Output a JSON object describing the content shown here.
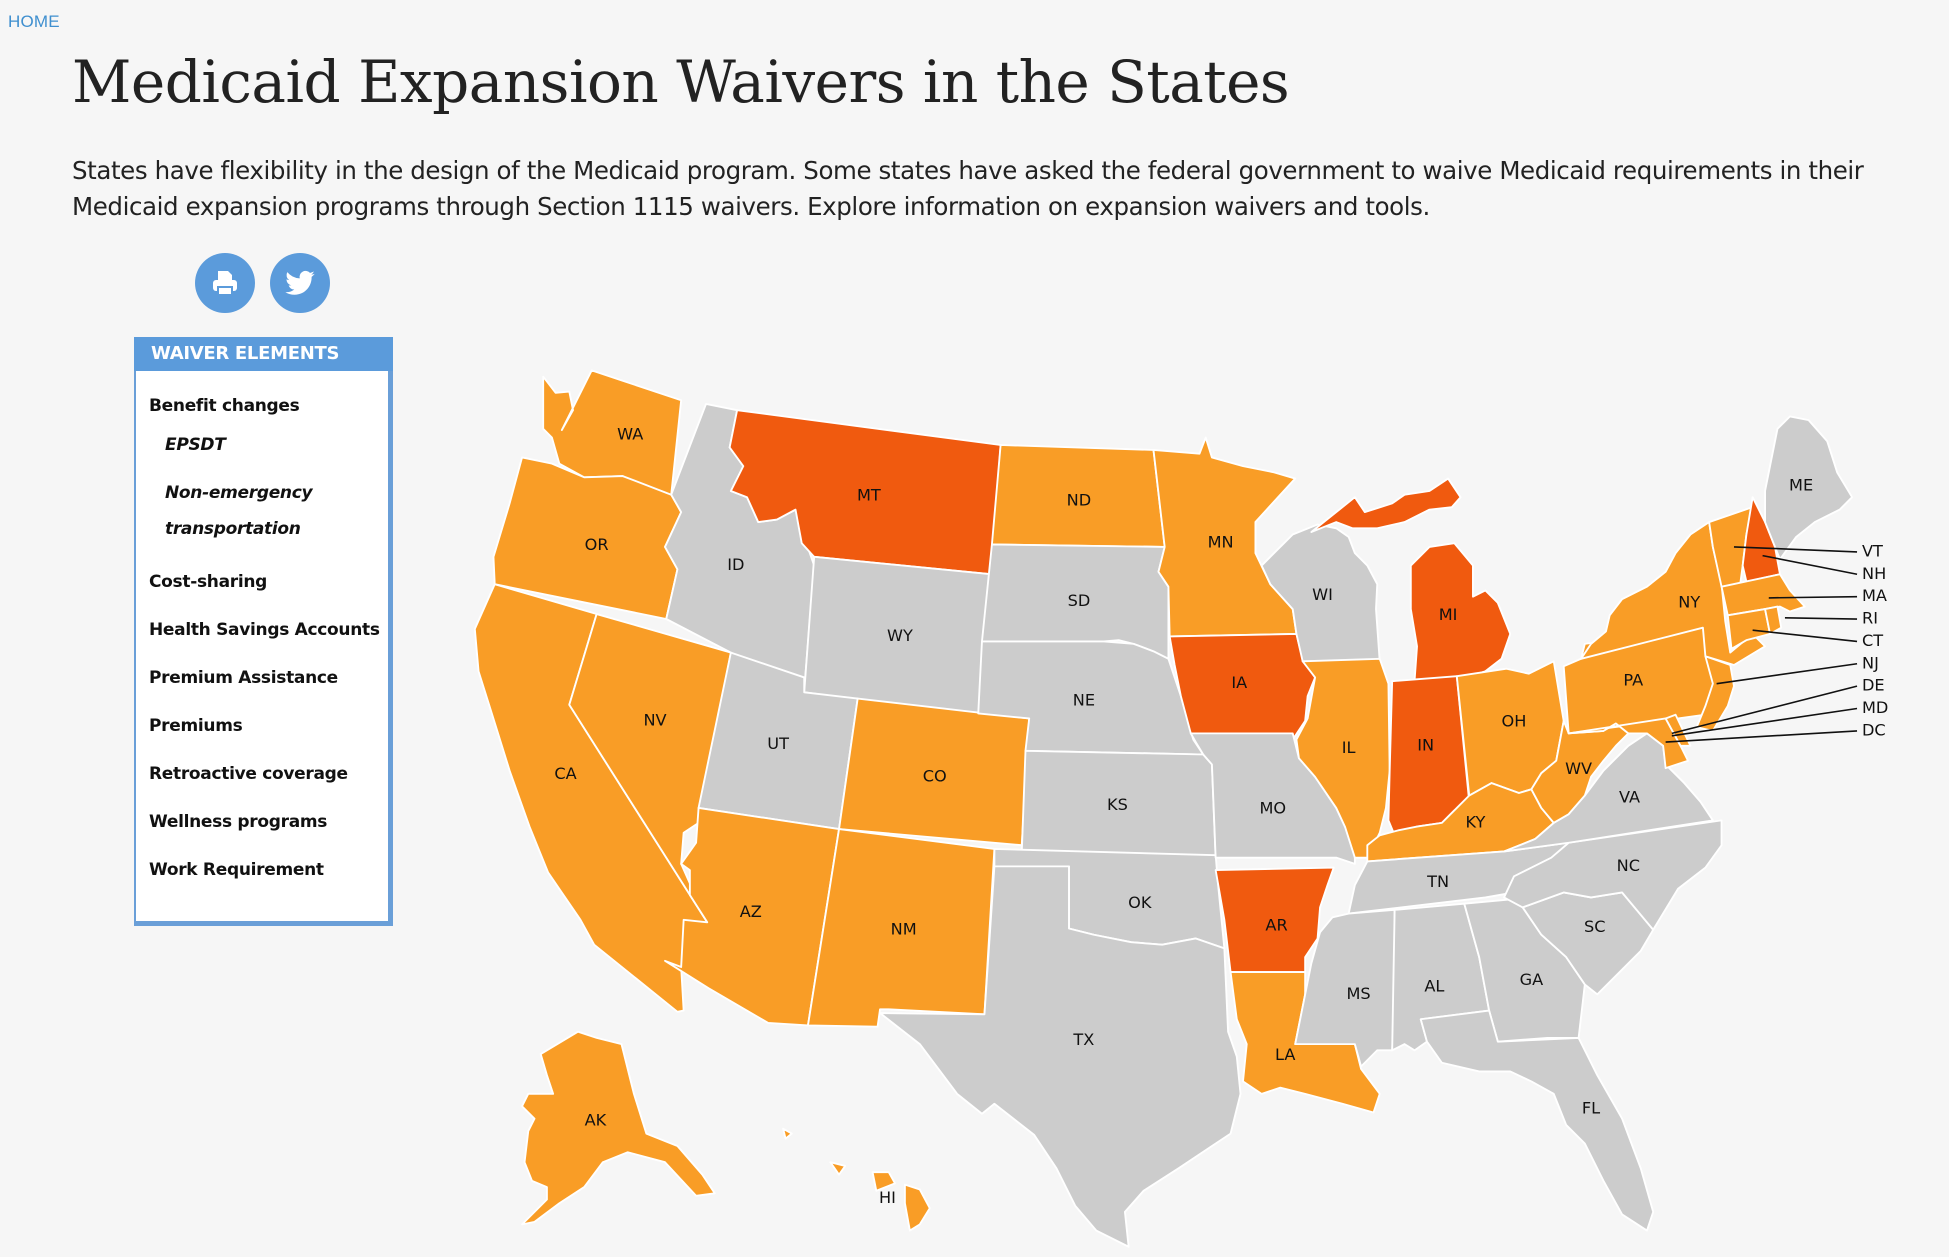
{
  "nav": {
    "home_label": "HOME"
  },
  "page": {
    "title": "Medicaid Expansion Waivers in the States",
    "intro": "States have flexibility in the design of the Medicaid program. Some states have asked the federal government to waive Medicaid requirements in their Medicaid expansion programs through Section 1115 waivers. Explore information on expansion waivers and tools."
  },
  "share": [
    {
      "icon": "print-icon",
      "label": "Print"
    },
    {
      "icon": "twitter-icon",
      "label": "Twitter"
    }
  ],
  "panel": {
    "header": "WAIVER ELEMENTS",
    "items": [
      {
        "label": "Benefit changes",
        "type": "group"
      },
      {
        "label": "EPSDT",
        "type": "sub"
      },
      {
        "label": "Non-emergency transportation",
        "type": "sub"
      },
      {
        "label": "Cost-sharing",
        "type": "item"
      },
      {
        "label": "Health Savings Accounts",
        "type": "item"
      },
      {
        "label": "Premium Assistance",
        "type": "item"
      },
      {
        "label": "Premiums",
        "type": "item"
      },
      {
        "label": "Retroactive coverage",
        "type": "item"
      },
      {
        "label": "Wellness programs",
        "type": "item"
      },
      {
        "label": "Work Requirement",
        "type": "item"
      }
    ]
  },
  "colors": {
    "category_a": "#f99d26",
    "category_b": "#f05a0f",
    "none": "#cccccc",
    "accent": "#5b9bdb"
  },
  "map": {
    "states": {
      "WA": "category_a",
      "OR": "category_a",
      "CA": "category_a",
      "NV": "category_a",
      "ID": "none",
      "MT": "category_b",
      "WY": "none",
      "UT": "none",
      "AZ": "category_a",
      "CO": "category_a",
      "NM": "category_a",
      "ND": "category_a",
      "SD": "none",
      "NE": "none",
      "KS": "none",
      "OK": "none",
      "TX": "none",
      "MN": "category_a",
      "IA": "category_b",
      "MO": "none",
      "AR": "category_b",
      "LA": "category_a",
      "WI": "none",
      "IL": "category_a",
      "MI": "category_b",
      "IN": "category_b",
      "OH": "category_a",
      "KY": "category_a",
      "TN": "none",
      "MS": "none",
      "AL": "none",
      "GA": "none",
      "FL": "none",
      "SC": "none",
      "NC": "none",
      "VA": "none",
      "WV": "category_a",
      "PA": "category_a",
      "NY": "category_a",
      "VT": "category_a",
      "NH": "category_b",
      "ME": "none",
      "MA": "category_a",
      "RI": "category_a",
      "CT": "category_a",
      "NJ": "category_a",
      "DE": "category_a",
      "MD": "category_a",
      "DC": "category_a",
      "AK": "category_a",
      "HI": "category_a"
    },
    "callout_labels": [
      "VT",
      "NH",
      "MA",
      "RI",
      "CT",
      "NJ",
      "DE",
      "MD",
      "DC"
    ]
  }
}
